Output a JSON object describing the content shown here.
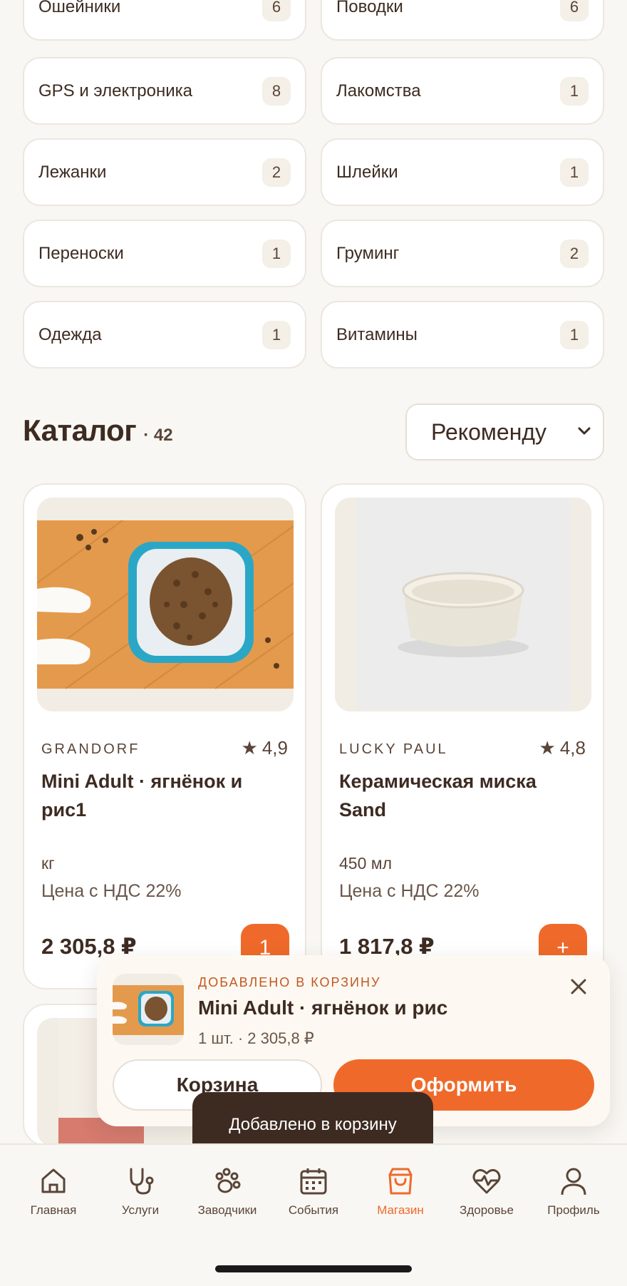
{
  "categories": [
    {
      "label": "Ошейники",
      "count": "6"
    },
    {
      "label": "Поводки",
      "count": "6"
    },
    {
      "label": "GPS и электроника",
      "count": "8"
    },
    {
      "label": "Лакомства",
      "count": "1"
    },
    {
      "label": "Лежанки",
      "count": "2"
    },
    {
      "label": "Шлейки",
      "count": "1"
    },
    {
      "label": "Переноски",
      "count": "1"
    },
    {
      "label": "Груминг",
      "count": "2"
    },
    {
      "label": "Одежда",
      "count": "1"
    },
    {
      "label": "Витамины",
      "count": "1"
    }
  ],
  "catalog": {
    "title": "Каталог",
    "count": "· 42",
    "sort_value": "Рекоменду"
  },
  "products": [
    {
      "brand": "GRANDORF",
      "rating": "4,9",
      "name": "Mini Adult · ягнёнок и рис1",
      "unit": "кг",
      "vat": "Цена с НДС 22%",
      "price": "2 305,8 ₽",
      "cart_qty": "1"
    },
    {
      "brand": "LUCKY PAUL",
      "rating": "4,8",
      "name": "Керамическая миска Sand",
      "unit": "450 мл",
      "vat": "Цена с НДС 22%",
      "price": "1 817,8 ₽",
      "add_symbol": "+"
    }
  ],
  "cart_popup": {
    "tag": "ДОБАВЛЕНО В КОРЗИНУ",
    "name": "Mini Adult · ягнёнок и рис",
    "meta": "1 шт. · 2 305,8 ₽",
    "cart_button": "Корзина",
    "checkout_button": "Оформить"
  },
  "toast": "Добавлено в корзину",
  "nav": [
    {
      "label": "Главная",
      "icon": "home-icon"
    },
    {
      "label": "Услуги",
      "icon": "stethoscope-icon"
    },
    {
      "label": "Заводчики",
      "icon": "paw-icon"
    },
    {
      "label": "События",
      "icon": "calendar-icon"
    },
    {
      "label": "Магазин",
      "icon": "shopping-bag-icon",
      "active": true
    },
    {
      "label": "Здоровье",
      "icon": "heart-pulse-icon"
    },
    {
      "label": "Профиль",
      "icon": "user-icon"
    }
  ],
  "colors": {
    "accent": "#ef6a2a",
    "text": "#3d2b22",
    "background": "#f9f7f3"
  }
}
